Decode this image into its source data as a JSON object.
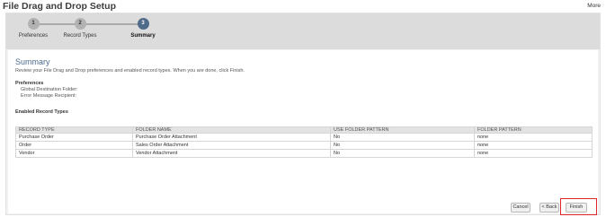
{
  "header": {
    "title": "File Drag and Drop Setup",
    "more_label": "More"
  },
  "steps": [
    {
      "number": "1",
      "label": "Preferences"
    },
    {
      "number": "2",
      "label": "Record Types"
    },
    {
      "number": "3",
      "label": "Summary"
    }
  ],
  "summary": {
    "heading": "Summary",
    "description": "Review your File Drag and Drop preferences and enabled record types. When you are done, click Finish.",
    "preferences": {
      "title": "Preferences",
      "global_destination_folder_label": "Global Destination Folder:",
      "error_message_recipient_label": "Error Message Recipient:"
    },
    "enabled_record_types": {
      "title": "Enabled Record Types",
      "columns": [
        "RECORD TYPE",
        "FOLDER NAME",
        "USE FOLDER PATTERN",
        "FOLDER PATTERN"
      ],
      "rows": [
        [
          "Purchase Order",
          "Purchase Order Attachment",
          "No",
          "none"
        ],
        [
          "Order",
          "Sales Order Attachment",
          "No",
          "none"
        ],
        [
          "Vendor",
          "Vendor Attachment",
          "No",
          "none"
        ]
      ]
    }
  },
  "footer": {
    "cancel_label": "Cancel",
    "back_label": "< Back",
    "finish_label": "Finish"
  },
  "colors": {
    "active_step": "#4f6b8a",
    "heading": "#4c6a8c",
    "highlight": "#e0262a"
  }
}
